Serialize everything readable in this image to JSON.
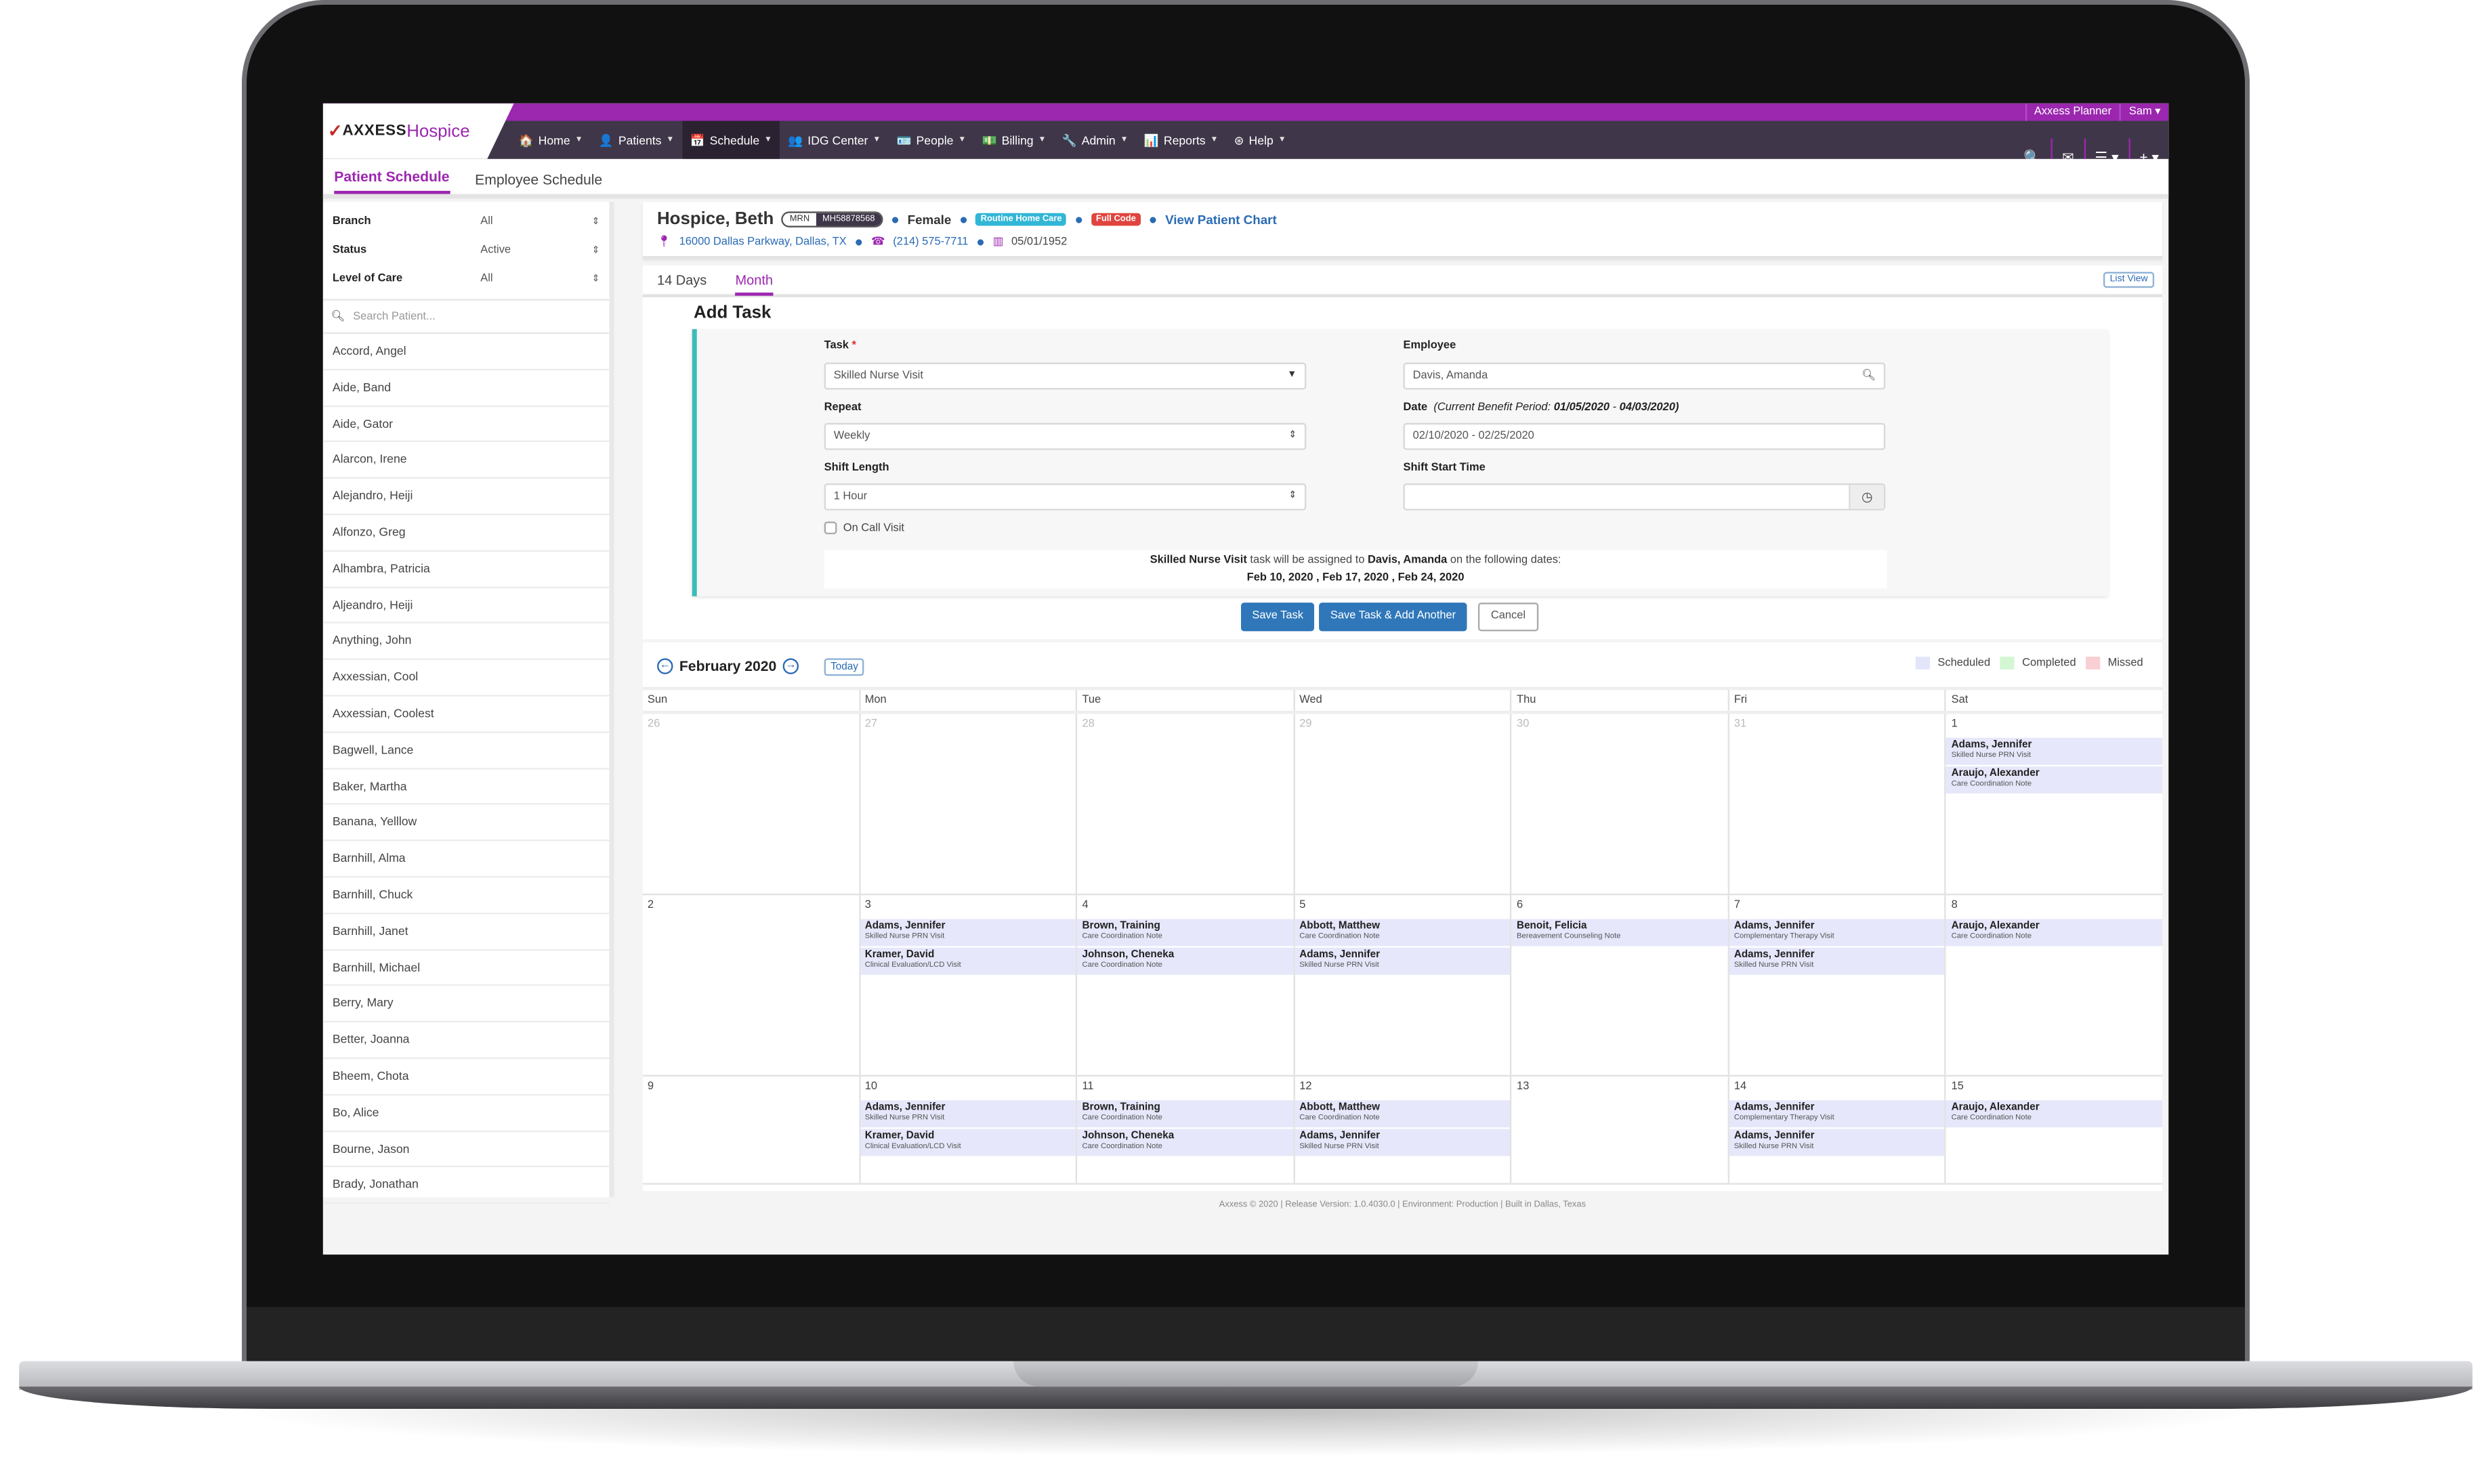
{
  "app": {
    "logo_mark": "✓",
    "logo_axxess": "AXXESS",
    "logo_hospice": "Hospice",
    "top_links": [
      {
        "icon": "calendar-check-icon",
        "label": "Axxess Planner"
      },
      {
        "icon": "user-circle-icon",
        "label": "Sam ▾"
      }
    ],
    "nav": [
      {
        "icon": "🏠",
        "label": "Home"
      },
      {
        "icon": "👤",
        "label": "Patients"
      },
      {
        "icon": "📅",
        "label": "Schedule",
        "active": true
      },
      {
        "icon": "👥",
        "label": "IDG Center"
      },
      {
        "icon": "🪪",
        "label": "People"
      },
      {
        "icon": "💵",
        "label": "Billing"
      },
      {
        "icon": "🔧",
        "label": "Admin"
      },
      {
        "icon": "📊",
        "label": "Reports"
      },
      {
        "icon": "⊛",
        "label": "Help"
      }
    ],
    "nav_right": [
      "🔍",
      "✉",
      "☰ ▾",
      "+ ▾"
    ],
    "caret": "▼"
  },
  "subtabs": [
    {
      "label": "Patient Schedule",
      "active": true
    },
    {
      "label": "Employee Schedule",
      "active": false
    }
  ],
  "sidebar": {
    "filters": [
      {
        "label": "Branch",
        "value": "All"
      },
      {
        "label": "Status",
        "value": "Active"
      },
      {
        "label": "Level of Care",
        "value": "All"
      }
    ],
    "updown": "⇕",
    "search_placeholder": "Search Patient...",
    "patients": [
      "Accord, Angel",
      "Aide, Band",
      "Aide, Gator",
      "Alarcon, Irene",
      "Alejandro, Heiji",
      "Alfonzo, Greg",
      "Alhambra, Patricia",
      "Aljeandro, Heiji",
      "Anything, John",
      "Axxessian, Cool",
      "Axxessian, Coolest",
      "Bagwell, Lance",
      "Baker, Martha",
      "Banana, Yelllow",
      "Barnhill, Alma",
      "Barnhill, Chuck",
      "Barnhill, Janet",
      "Barnhill, Michael",
      "Berry, Mary",
      "Better, Joanna",
      "Bheem, Chota",
      "Bo, Alice",
      "Bourne, Jason",
      "Brady, Jonathan"
    ]
  },
  "patient": {
    "name": "Hospice, Beth",
    "mrn_label": "MRN",
    "mrn": "MH58878568",
    "gender": "Female",
    "level_badge": "Routine Home Care",
    "level_color": "#31b6d6",
    "code_badge": "Full Code",
    "code_color": "#e0443e",
    "chart_link": "View Patient Chart",
    "address": "16000 Dallas Parkway, Dallas, TX",
    "phone": "(214) 575-7711",
    "dob": "05/01/1952"
  },
  "views": {
    "tabs": [
      {
        "label": "14 Days",
        "active": false
      },
      {
        "label": "Month",
        "active": true
      }
    ],
    "list_view": "List View"
  },
  "add_task": {
    "title": "Add Task",
    "task_label": "Task",
    "required": "*",
    "task_value": "Skilled Nurse Visit",
    "repeat_label": "Repeat",
    "repeat_value": "Weekly",
    "shift_length_label": "Shift Length",
    "shift_length_value": "1 Hour",
    "on_call_label": "On Call Visit",
    "on_call_checked": false,
    "employee_label": "Employee",
    "employee_value": "Davis, Amanda",
    "date_label": "Date",
    "date_period_prefix": "(Current Benefit Period:",
    "date_period_start": "01/05/2020",
    "date_period_sep": " - ",
    "date_period_end": "04/03/2020)",
    "date_value": "02/10/2020 - 02/25/2020",
    "shift_start_label": "Shift Start Time",
    "shift_start_value": "",
    "summary_task": "Skilled Nurse Visit",
    "summary_mid": " task will be assigned to ",
    "summary_emp": "Davis, Amanda",
    "summary_end": " on the following dates:",
    "summary_dates": "Feb 10, 2020 ,  Feb 17, 2020 ,  Feb 24, 2020",
    "save": "Save Task",
    "save_another": "Save Task & Add Another",
    "cancel": "Cancel"
  },
  "calendar": {
    "month": "February 2020",
    "prev": "←",
    "next": "→",
    "today": "Today",
    "legend": [
      {
        "label": "Scheduled",
        "color": "#e3e5fb"
      },
      {
        "label": "Completed",
        "color": "#d3f7d3"
      },
      {
        "label": "Missed",
        "color": "#f8cfd2"
      }
    ],
    "dow": [
      "Sun",
      "Mon",
      "Tue",
      "Wed",
      "Thu",
      "Fri",
      "Sat"
    ],
    "weeks": [
      [
        {
          "d": "26",
          "o": true,
          "e": []
        },
        {
          "d": "27",
          "o": true,
          "e": []
        },
        {
          "d": "28",
          "o": true,
          "e": []
        },
        {
          "d": "29",
          "o": true,
          "e": []
        },
        {
          "d": "30",
          "o": true,
          "e": []
        },
        {
          "d": "31",
          "o": true,
          "e": []
        },
        {
          "d": "1",
          "e": [
            {
              "n": "Adams, Jennifer",
              "t": "Skilled Nurse PRN Visit"
            },
            {
              "n": "Araujo, Alexander",
              "t": "Care Coordination Note"
            }
          ]
        }
      ],
      [
        {
          "d": "2",
          "e": []
        },
        {
          "d": "3",
          "e": [
            {
              "n": "Adams, Jennifer",
              "t": "Skilled Nurse PRN Visit"
            },
            {
              "n": "Kramer, David",
              "t": "Clinical Evaluation/LCD Visit"
            }
          ]
        },
        {
          "d": "4",
          "e": [
            {
              "n": "Brown, Training",
              "t": "Care Coordination Note"
            },
            {
              "n": "Johnson, Cheneka",
              "t": "Care Coordination Note"
            }
          ]
        },
        {
          "d": "5",
          "e": [
            {
              "n": "Abbott, Matthew",
              "t": "Care Coordination Note"
            },
            {
              "n": "Adams, Jennifer",
              "t": "Skilled Nurse PRN Visit"
            }
          ]
        },
        {
          "d": "6",
          "e": [
            {
              "n": "Benoit, Felicia",
              "t": "Bereavement Counseling Note"
            }
          ]
        },
        {
          "d": "7",
          "e": [
            {
              "n": "Adams, Jennifer",
              "t": "Complementary Therapy Visit"
            },
            {
              "n": "Adams, Jennifer",
              "t": "Skilled Nurse PRN Visit"
            }
          ]
        },
        {
          "d": "8",
          "e": [
            {
              "n": "Araujo, Alexander",
              "t": "Care Coordination Note"
            }
          ]
        }
      ],
      [
        {
          "d": "9",
          "e": []
        },
        {
          "d": "10",
          "e": [
            {
              "n": "Adams, Jennifer",
              "t": "Skilled Nurse PRN Visit"
            },
            {
              "n": "Kramer, David",
              "t": "Clinical Evaluation/LCD Visit"
            }
          ]
        },
        {
          "d": "11",
          "e": [
            {
              "n": "Brown, Training",
              "t": "Care Coordination Note"
            },
            {
              "n": "Johnson, Cheneka",
              "t": "Care Coordination Note"
            }
          ]
        },
        {
          "d": "12",
          "e": [
            {
              "n": "Abbott, Matthew",
              "t": "Care Coordination Note"
            },
            {
              "n": "Adams, Jennifer",
              "t": "Skilled Nurse PRN Visit"
            }
          ]
        },
        {
          "d": "13",
          "e": []
        },
        {
          "d": "14",
          "e": [
            {
              "n": "Adams, Jennifer",
              "t": "Complementary Therapy Visit"
            },
            {
              "n": "Adams, Jennifer",
              "t": "Skilled Nurse PRN Visit"
            }
          ]
        },
        {
          "d": "15",
          "e": [
            {
              "n": "Araujo, Alexander",
              "t": "Care Coordination Note"
            }
          ]
        }
      ]
    ]
  },
  "footer": "Axxess © 2020 | Release Version: 1.0.4030.0 | Environment: Production | Built in Dallas, Texas"
}
